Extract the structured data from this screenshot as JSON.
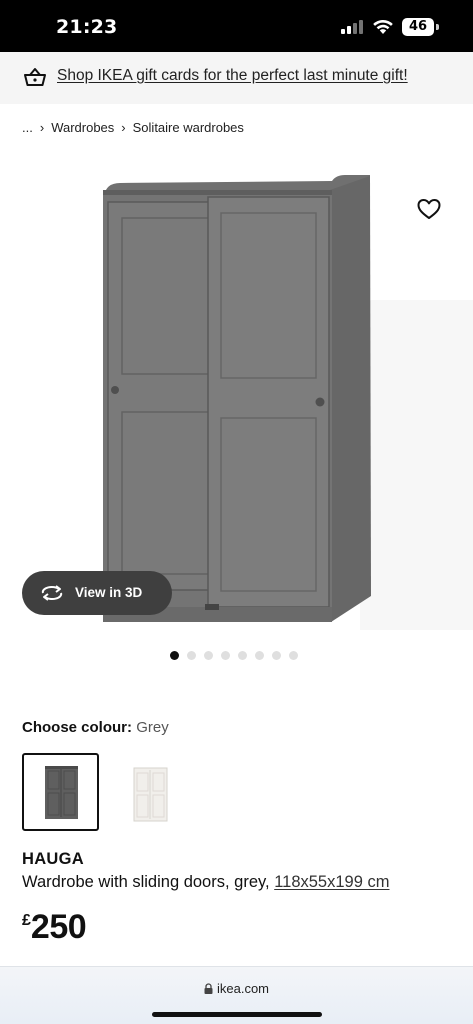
{
  "status_bar": {
    "time": "21:23",
    "battery": "46"
  },
  "promo": {
    "text": "Shop IKEA gift cards for the perfect last minute gift!",
    "icon": "basket-icon"
  },
  "breadcrumb": {
    "ellipsis": "...",
    "items": [
      "Wardrobes",
      "Solitaire wardrobes"
    ]
  },
  "gallery": {
    "view_3d_label": "View in 3D",
    "dot_count": 8,
    "active_dot": 1,
    "favourite_icon": "heart-icon"
  },
  "colour": {
    "label": "Choose colour:",
    "value": "Grey",
    "options": [
      {
        "name": "grey",
        "color": "#6e6e6e",
        "selected": true
      },
      {
        "name": "white",
        "color": "#f2f0ec",
        "selected": false
      }
    ]
  },
  "product": {
    "name": "HAUGA",
    "description": "Wardrobe with sliding doors, grey, ",
    "size": "118x55x199 cm",
    "currency": "£",
    "price": "250"
  },
  "browser": {
    "url": "ikea.com"
  }
}
